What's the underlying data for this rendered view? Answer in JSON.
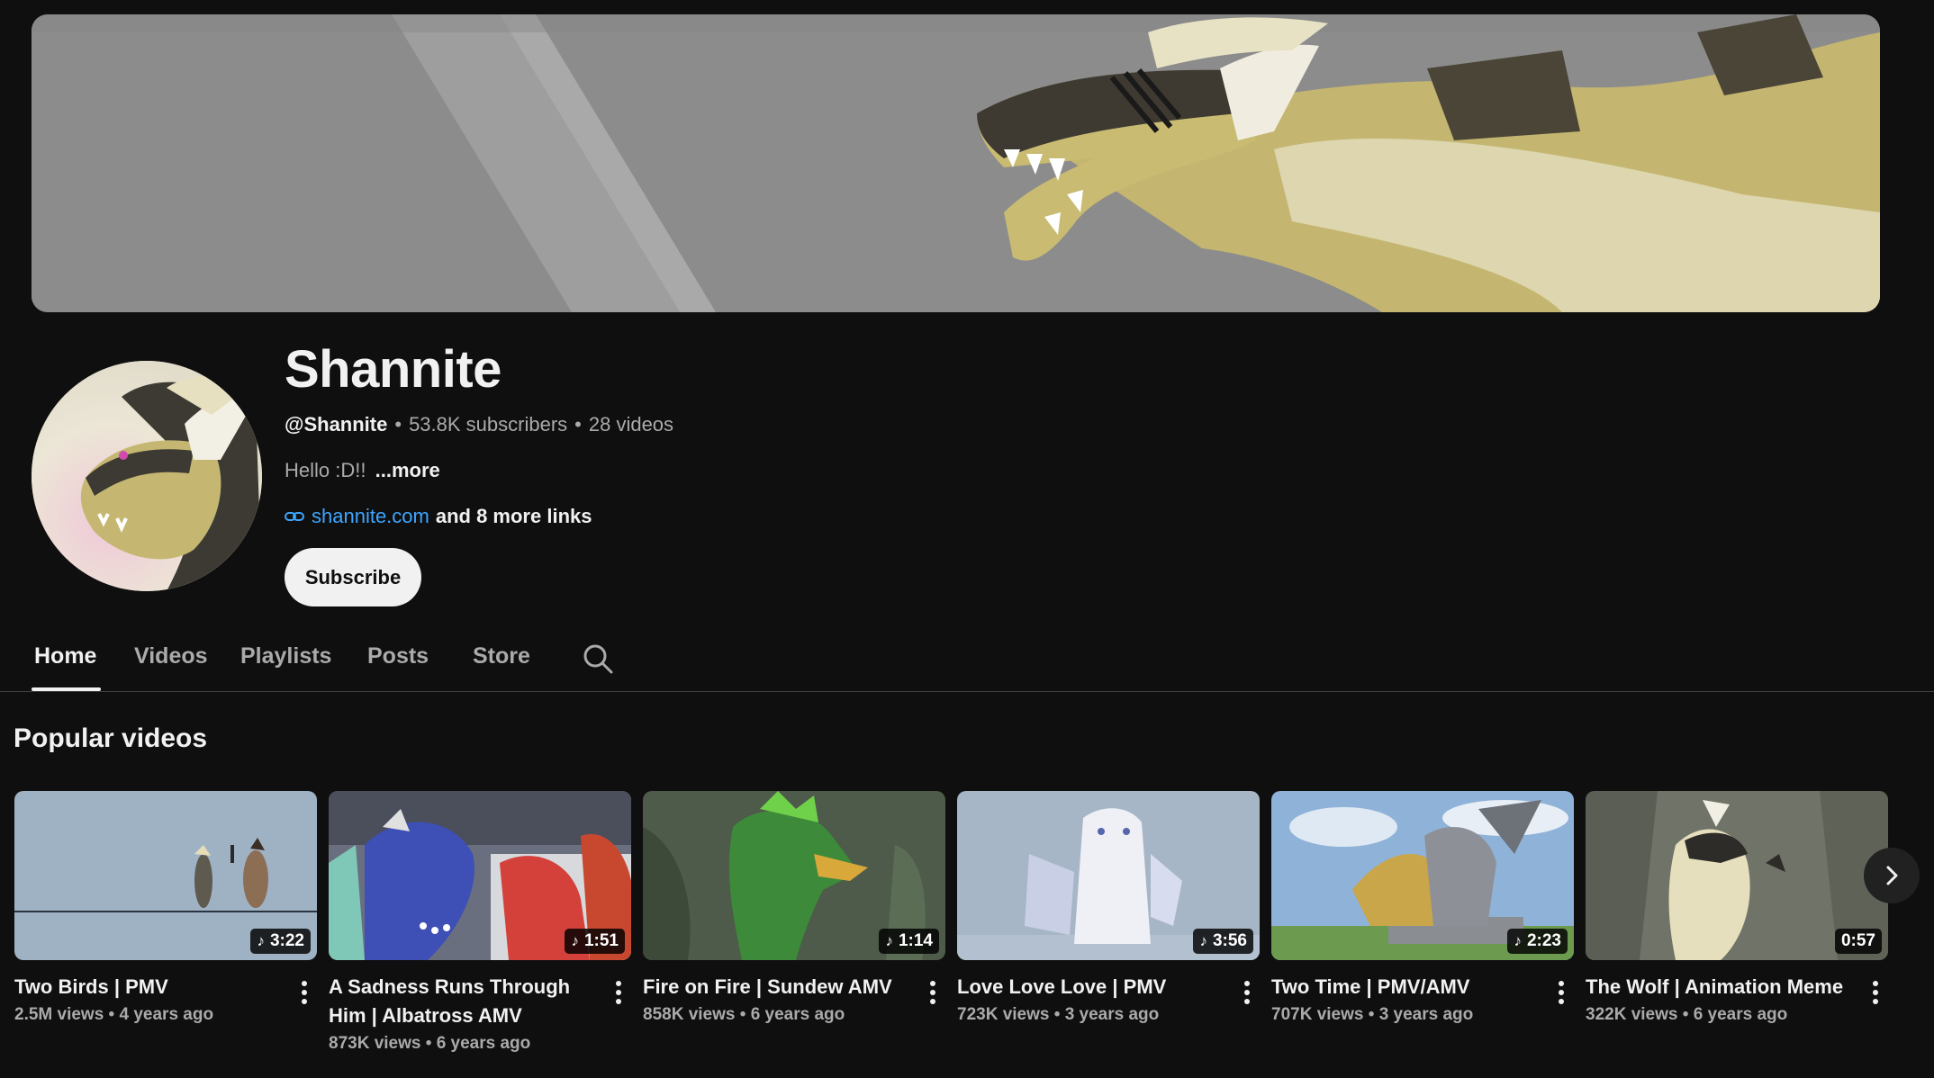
{
  "channel": {
    "name": "Shannite",
    "handle": "@Shannite",
    "subscribers": "53.8K subscribers",
    "videos_count": "28 videos",
    "description": "Hello :D!!",
    "more_label": "...more",
    "link_url": "shannite.com",
    "more_links": "and 8 more links",
    "subscribe_label": "Subscribe"
  },
  "tabs": [
    {
      "label": "Home",
      "active": true
    },
    {
      "label": "Videos"
    },
    {
      "label": "Playlists"
    },
    {
      "label": "Posts"
    },
    {
      "label": "Store"
    }
  ],
  "section": {
    "title": "Popular videos"
  },
  "videos": [
    {
      "title": "Two Birds | PMV",
      "duration": "3:22",
      "music": true,
      "views": "2.5M views",
      "age": "4 years ago"
    },
    {
      "title": "A Sadness Runs Through Him | Albatross AMV",
      "duration": "1:51",
      "music": true,
      "views": "873K views",
      "age": "6 years ago"
    },
    {
      "title": "Fire on Fire | Sundew AMV",
      "duration": "1:14",
      "music": true,
      "views": "858K views",
      "age": "6 years ago"
    },
    {
      "title": "Love Love Love | PMV",
      "duration": "3:56",
      "music": true,
      "views": "723K views",
      "age": "3 years ago"
    },
    {
      "title": "Two Time | PMV/AMV",
      "duration": "2:23",
      "music": true,
      "views": "707K views",
      "age": "3 years ago"
    },
    {
      "title": "The Wolf | Animation Meme",
      "duration": "0:57",
      "music": false,
      "views": "322K views",
      "age": "6 years ago"
    }
  ],
  "icons": {
    "link": "link-icon",
    "search": "search-icon",
    "music": "music-note-icon",
    "more": "more-vert-icon",
    "next": "chevron-right-icon"
  },
  "colors": {
    "background": "#0f0f0f",
    "link": "#3ea6ff",
    "subscribe_bg": "#f1f1f1",
    "secondary_text": "#aaaaaa"
  }
}
